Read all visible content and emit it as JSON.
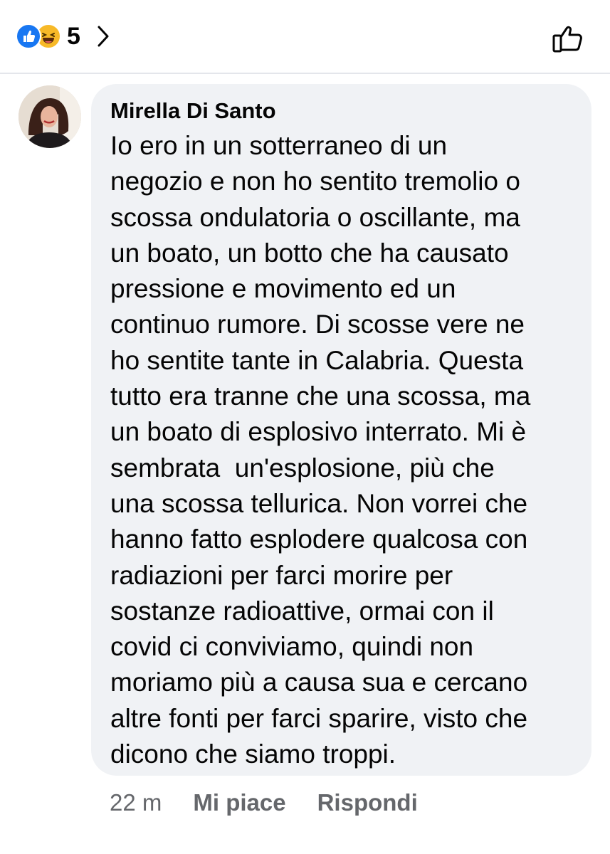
{
  "reactions": {
    "count": "5",
    "types": [
      "like-icon",
      "haha-icon"
    ],
    "colors": {
      "like": "#1877f2",
      "haha": "#f7b928"
    }
  },
  "comment": {
    "author": "Mirella Di Santo",
    "text": "Io ero in un sotterraneo di un\nnegozio e non ho sentito tremolio o\nscossa ondulatoria o oscillante, ma\nun boato, un botto che ha causato\npressione e movimento ed un\ncontinuo rumore. Di scosse vere ne\nho sentite tante in Calabria. Questa\ntutto era tranne che una scossa, ma\nun boato di esplosivo interrato. Mi è\nsembrata  un'esplosione, più che\nuna scossa tellurica. Non vorrei che\nhanno fatto esplodere qualcosa con\nradiazioni per farci morire per\nsostanze radioattive, ormai con il\ncovid ci conviviamo, quindi non\nmoriamo più a causa sua e cercano\naltre fonti per farci sparire, visto che\ndicono che siamo troppi."
  },
  "meta": {
    "time": "22 m",
    "like_label": "Mi piace",
    "reply_label": "Rispondi"
  }
}
